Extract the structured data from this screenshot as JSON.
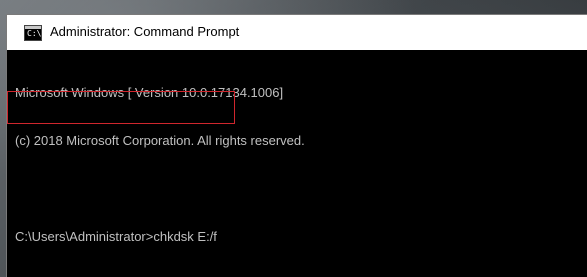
{
  "window": {
    "title": "Administrator: Command Prompt",
    "icon": "cmd-icon",
    "icon_glyph": "C:\\"
  },
  "console": {
    "lines": [
      "Microsoft Windows [ Version 10.0.17134.1006]",
      "(c) 2018 Microsoft Corporation. All rights reserved.",
      "",
      "C:\\Users\\Administrator>chkdsk E:/f"
    ]
  },
  "colors": {
    "console_bg": "#000000",
    "console_text": "#c0c0c0",
    "titlebar_bg": "#ffffff",
    "highlight": "#d0262d"
  }
}
